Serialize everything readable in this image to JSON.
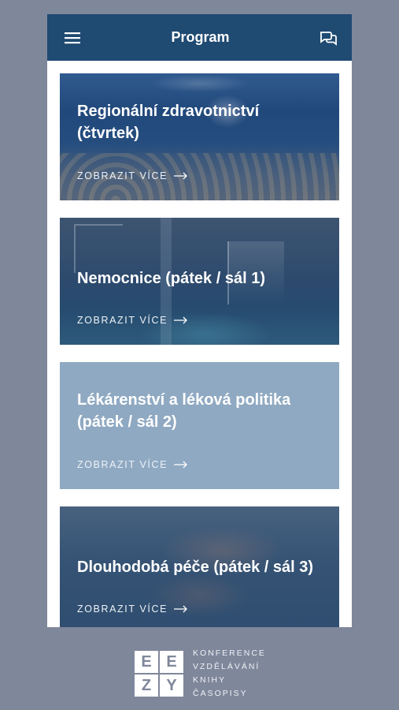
{
  "header": {
    "title": "Program",
    "menu_icon": "hamburger-icon",
    "chat_icon": "chat-bubbles-icon"
  },
  "cards": [
    {
      "title_line1": "Regionální zdravotnictví",
      "title_line2": "(čtvrtek)",
      "more": "ZOBRAZIT VÍCE"
    },
    {
      "title_line1": "Nemocnice (pátek / sál 1)",
      "title_line2": "",
      "more": "ZOBRAZIT VÍCE"
    },
    {
      "title_line1": "Lékárenství a léková politika",
      "title_line2": "(pátek / sál 2)",
      "more": "ZOBRAZIT VÍCE"
    },
    {
      "title_line1": "Dlouhodobá péče (pátek / sál 3)",
      "title_line2": "",
      "more": "ZOBRAZIT VÍCE"
    }
  ],
  "brand": {
    "logo_letters": [
      "E",
      "E",
      "Z",
      "Y"
    ],
    "lines": [
      "KONFERENCE",
      "VZDĚLÁVÁNÍ",
      "KNIHY",
      "ČASOPISY"
    ]
  },
  "colors": {
    "header": "#1f4a72",
    "background": "#7f879b",
    "plain_card": "#8fa9c2"
  }
}
